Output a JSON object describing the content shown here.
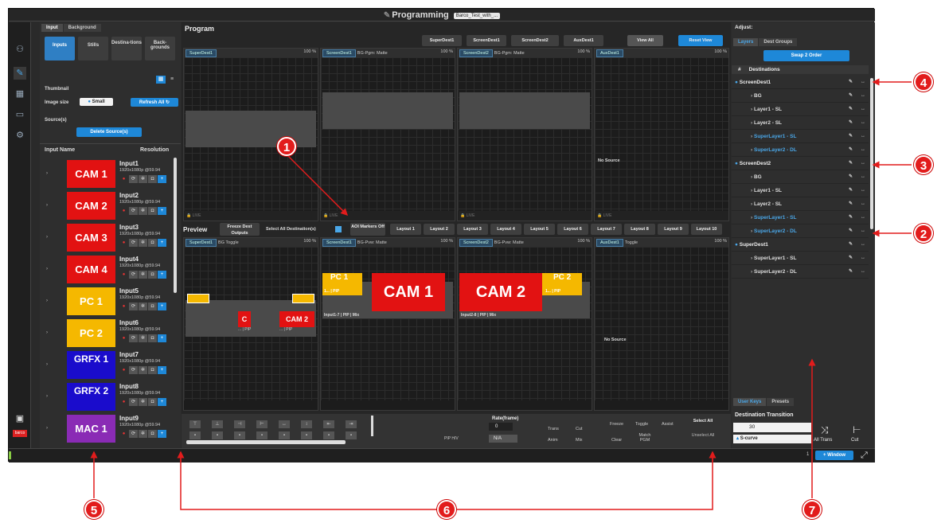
{
  "title": "Programming",
  "title_chip": "Barco_Test_with_...",
  "left_tabs": [
    "Input",
    "Background"
  ],
  "source_tabs": [
    "Inputs",
    "Stills",
    "Destina-tions",
    "Back-grounds"
  ],
  "thumbnail_label": "Thumbnail",
  "image_size_label": "Image size",
  "image_size_value": "Small",
  "refresh_all": "Refresh All",
  "sources_label": "Source(s)",
  "delete_sources": "Delete Source(s)",
  "input_header": {
    "name": "Input Name",
    "resolution": "Resolution"
  },
  "inputs": [
    {
      "tile": "CAM 1",
      "color": "#e21212",
      "name": "Input1",
      "res": "1920x1080p @59.94"
    },
    {
      "tile": "CAM 2",
      "color": "#e21212",
      "name": "Input2",
      "res": "1920x1080p @59.94"
    },
    {
      "tile": "CAM 3",
      "color": "#e21212",
      "name": "Input3",
      "res": "1920x1080p @59.94"
    },
    {
      "tile": "CAM 4",
      "color": "#e21212",
      "name": "Input4",
      "res": "1920x1080p @59.94"
    },
    {
      "tile": "PC 1",
      "color": "#f5b800",
      "name": "Input5",
      "res": "1920x1080p @59.94"
    },
    {
      "tile": "PC 2",
      "color": "#f5b800",
      "name": "Input6",
      "res": "1920x1080p @59.94"
    },
    {
      "tile": "GRFX 1",
      "color": "#1a0ccc",
      "name": "Input7",
      "res": "1920x1080p @59.94"
    },
    {
      "tile": "GRFX 2",
      "color": "#1a0ccc",
      "name": "Input8",
      "res": "1920x1080p @59.94"
    },
    {
      "tile": "MAC 1",
      "color": "#8a2bb5",
      "name": "Input9",
      "res": "1920x1080p @59.94"
    }
  ],
  "program": {
    "label": "Program",
    "buttons": [
      "SuperDest1",
      "ScreenDest1",
      "ScreenDest2",
      "AuxDest1",
      "View All",
      "Reset View"
    ],
    "views": [
      {
        "dest": "SuperDest1",
        "extra": "",
        "zoom": "100 %",
        "live": "LIVE",
        "nosource": ""
      },
      {
        "dest": "ScreenDest1",
        "extra": "BG-Pgm: Matte",
        "zoom": "100 %",
        "live": "LIVE",
        "nosource": ""
      },
      {
        "dest": "ScreenDest2",
        "extra": "BG-Pgm: Matte",
        "zoom": "100 %",
        "live": "LIVE",
        "nosource": ""
      },
      {
        "dest": "AuxDest1",
        "extra": "",
        "zoom": "100 %",
        "live": "LIVE",
        "nosource": "No Source"
      }
    ]
  },
  "preview": {
    "label": "Preview",
    "freeze": "Freeze Dest Outputs",
    "select_all": "Select All Destination(s)",
    "aoi": "AOI Markers Off",
    "layouts": [
      "Layout 1",
      "Layout 2",
      "Layout 3",
      "Layout 4",
      "Layout 5",
      "Layout 6",
      "Layout 7",
      "Layout 8",
      "Layout 9",
      "Layout 10"
    ],
    "views": [
      {
        "dest": "SuperDest1",
        "extra": "BG Toggle",
        "zoom": "100 %"
      },
      {
        "dest": "ScreenDest1",
        "extra": "BG-Pvw: Matte",
        "zoom": "100 %"
      },
      {
        "dest": "ScreenDest2",
        "extra": "BG-Pvw: Matte",
        "zoom": "100 %"
      },
      {
        "dest": "AuxDest1",
        "extra": "Toggle",
        "zoom": "100 %"
      }
    ],
    "cam1": "CAM 1",
    "cam2": "CAM 2",
    "pc1": "PC 1",
    "pc2": "PC 2",
    "cap1": "Input1-7 | PIP | Mix",
    "cap2": "Input2-8 | PIP | Mix",
    "pip1": "1... | PIP",
    "pip2": "1... | PIP",
    "small_cam2": "CAM 2",
    "small_c": "C",
    "small_pip": "... | PIP",
    "nosource": "No Source"
  },
  "controls": {
    "pip_hv": "PIP H/V",
    "rate_label": "Rate(frame)",
    "rate_value": "0",
    "na": "N/A",
    "trans": "Trans",
    "cut": "Cut",
    "anim": "Anim",
    "mix": "Mix",
    "freeze": "Freeze",
    "toggle": "Toggle",
    "assist": "Assist",
    "clear": "Clear",
    "match_pgm": "Match PGM",
    "select_all": "Select All",
    "unselect_all": "Unselect All"
  },
  "right": {
    "adjust": "Adjust:",
    "tabs": [
      "Layers",
      "Dest Groups"
    ],
    "swap": "Swap 2 Order",
    "dest_header": "Destinations",
    "rows": [
      {
        "label": "ScreenDest1",
        "kind": "main"
      },
      {
        "label": "BG",
        "kind": "sub"
      },
      {
        "label": "Layer1 - SL",
        "kind": "sub"
      },
      {
        "label": "Layer2 - SL",
        "kind": "sub"
      },
      {
        "label": "SuperLayer1 - SL",
        "kind": "blue"
      },
      {
        "label": "SuperLayer2 - DL",
        "kind": "blue"
      },
      {
        "label": "ScreenDest2",
        "kind": "main"
      },
      {
        "label": "BG",
        "kind": "sub"
      },
      {
        "label": "Layer1 - SL",
        "kind": "sub"
      },
      {
        "label": "Layer2 - SL",
        "kind": "sub"
      },
      {
        "label": "SuperLayer1 - SL",
        "kind": "blue"
      },
      {
        "label": "SuperLayer2 - DL",
        "kind": "blue"
      },
      {
        "label": "SuperDest1",
        "kind": "main"
      },
      {
        "label": "SuperLayer1 - SL",
        "kind": "sub"
      },
      {
        "label": "SuperLayer2 - DL",
        "kind": "sub"
      }
    ],
    "bottom_tabs": [
      "User Keys",
      "Presets"
    ],
    "dest_transition": "Destination Transition",
    "dt_value": "30",
    "curve": "S-curve",
    "all_trans": "All Trans",
    "cut": "Cut"
  },
  "status": {
    "page": "1",
    "window": "+ Window"
  },
  "callouts": [
    "1",
    "2",
    "3",
    "4",
    "5",
    "6",
    "7"
  ]
}
